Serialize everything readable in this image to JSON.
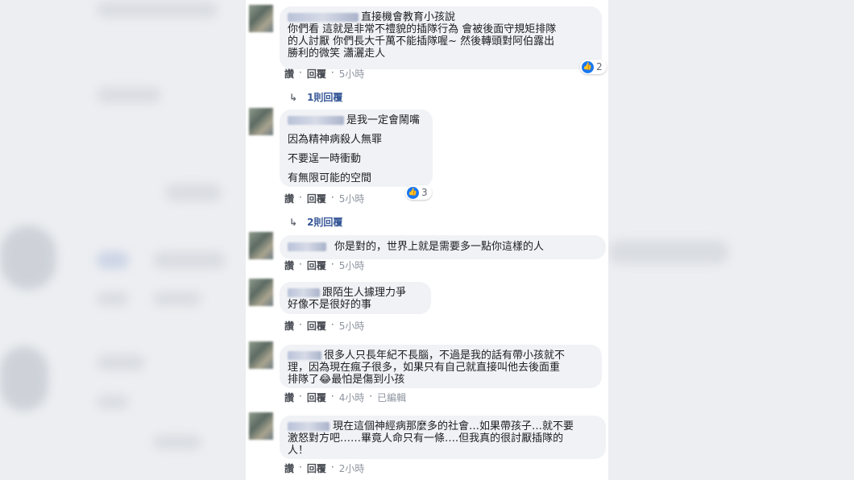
{
  "comments": [
    {
      "lines": [
        "直接機會教育小孩說",
        "你們看 這就是非常不禮貌的插隊行為 會被後面守規矩排隊",
        "的人討厭 你們長大千萬不能插隊喔~ 然後轉頭對阿伯露出",
        "勝利的微笑 瀟灑走人"
      ],
      "reaction_count": "2",
      "actions": {
        "like": "讚",
        "reply": "回覆",
        "time": "5小時"
      },
      "replies": "1則回覆"
    },
    {
      "lines": [
        "是我一定會鬧嘴",
        "因為精神病殺人無罪",
        "不要逞一時衝動",
        "有無限可能的空間"
      ],
      "reaction_count": "3",
      "actions": {
        "like": "讚",
        "reply": "回覆",
        "time": "5小時"
      },
      "replies": "2則回覆"
    },
    {
      "lines": [
        "你是對的，世界上就是需要多一點你這樣的人"
      ],
      "actions": {
        "like": "讚",
        "reply": "回覆",
        "time": "5小時"
      }
    },
    {
      "lines": [
        "跟陌生人據理力爭",
        "好像不是很好的事"
      ],
      "actions": {
        "like": "讚",
        "reply": "回覆",
        "time": "5小時"
      }
    },
    {
      "lines": [
        "很多人只長年紀不長腦，不過是我的話有帶小孩就不",
        "理，因為現在瘋子很多，如果只有自己就直接叫他去後面重",
        "排隊了😂最怕是傷到小孩"
      ],
      "actions": {
        "like": "讚",
        "reply": "回覆",
        "time": "4小時",
        "edited": "已編輯"
      }
    },
    {
      "lines": [
        "現在這個神經病那麼多的社會…如果帶孩子…就不要",
        "激怒對方吧……畢竟人命只有一條….但我真的很討厭插隊的",
        "人！"
      ],
      "actions": {
        "like": "讚",
        "reply": "回覆",
        "time": "2小時"
      }
    }
  ],
  "icons": {
    "like": "thumbs-up-icon",
    "reply_arrow": "reply-arrow-icon"
  },
  "colors": {
    "accent": "#1877f2",
    "bubble": "#f0f2f5",
    "link": "#385898"
  }
}
